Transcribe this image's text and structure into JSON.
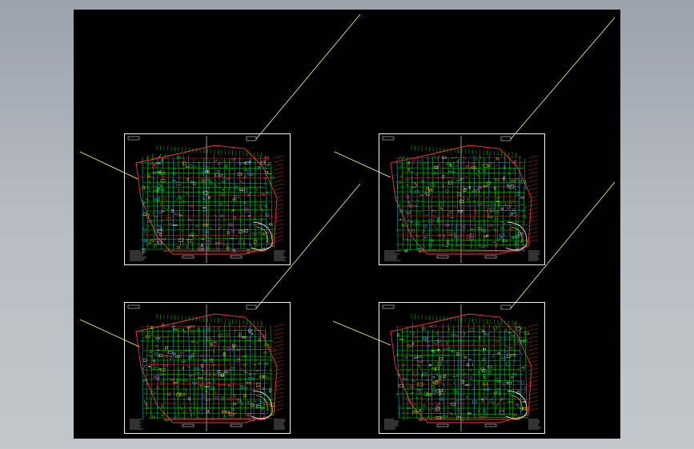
{
  "app": {
    "view": "cad-drawing-preview",
    "background_color": "#a9b0b9",
    "canvas_color": "#000000"
  },
  "sheets": [
    {
      "id": "sheet-1",
      "palette": [
        "#00ff00",
        "#ff3030",
        "#00e5ff",
        "#ffffff",
        "#ffff00",
        "#ff40ff"
      ]
    },
    {
      "id": "sheet-2",
      "palette": [
        "#00ff00",
        "#ff3030",
        "#00e5ff",
        "#ffffff",
        "#ffff00",
        "#ff40ff"
      ]
    },
    {
      "id": "sheet-3",
      "palette": [
        "#00ff00",
        "#ff3030",
        "#00e5ff",
        "#ffffff",
        "#ffff00",
        "#ff40ff"
      ]
    },
    {
      "id": "sheet-4",
      "palette": [
        "#00ff00",
        "#ff3030",
        "#00e5ff",
        "#ffffff",
        "#ffff00",
        "#ff40ff"
      ]
    }
  ],
  "leader_color": "#ffff66"
}
